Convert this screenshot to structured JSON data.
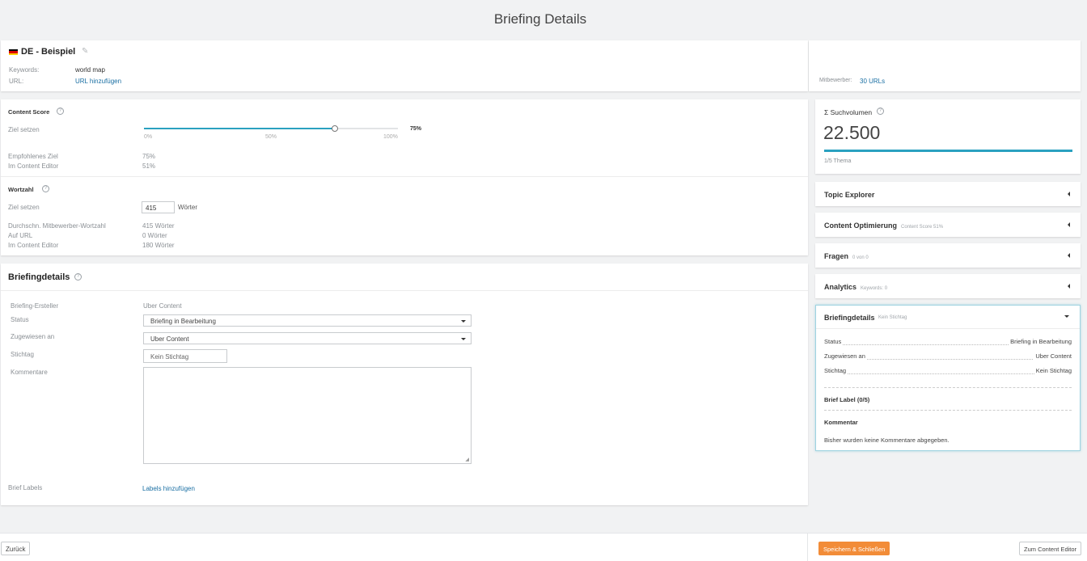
{
  "page_title": "Briefing Details",
  "header": {
    "title": "DE - Beispiel",
    "keywords_label": "Keywords:",
    "keywords_value": "world map",
    "url_label": "URL:",
    "url_link": "URL hinzufügen",
    "competitors_label": "Mitbewerber:",
    "competitors_link": "30 URLs"
  },
  "content_score": {
    "title": "Content Score",
    "goal_label": "Ziel setzen",
    "slider_value": 75,
    "slider_value_text": "75%",
    "ticks": [
      "0%",
      "50%",
      "100%"
    ],
    "recommended_label": "Empfohlenes Ziel",
    "recommended_value": "75%",
    "in_editor_label": "Im Content Editor",
    "in_editor_value": "51%"
  },
  "word_count": {
    "title": "Wortzahl",
    "goal_label": "Ziel setzen",
    "goal_value": "415",
    "unit": "Wörter",
    "avg_label": "Durchschn. Mitbewerber-Wortzahl",
    "avg_value": "415 Wörter",
    "url_label": "Auf URL",
    "url_value": "0 Wörter",
    "editor_label": "Im Content Editor",
    "editor_value": "180 Wörter"
  },
  "briefing": {
    "title": "Briefingdetails",
    "creator_label": "Briefing-Ersteller",
    "creator_value": "Uber Content",
    "status_label": "Status",
    "status_value": "Briefing in Bearbeitung",
    "assigned_label": "Zugewiesen an",
    "assigned_value": "Uber Content",
    "due_label": "Stichtag",
    "due_placeholder": "Kein Stichtag",
    "comments_label": "Kommentare",
    "labels_label": "Brief Labels",
    "labels_link": "Labels hinzufügen"
  },
  "search_volume": {
    "title": "Σ Suchvolumen",
    "value": "22.500",
    "sub": "1/5 Thema",
    "bar_fill": 1.0
  },
  "sidebar_panels": [
    {
      "title": "Topic Explorer",
      "sub": ""
    },
    {
      "title": "Content Optimierung",
      "sub": "Content Score 51%"
    },
    {
      "title": "Fragen",
      "sub": "0 von 0"
    },
    {
      "title": "Analytics",
      "sub": "Keywords: 0"
    }
  ],
  "briefing_panel": {
    "title": "Briefingdetails",
    "sub": "Kein Stichtag",
    "status_label": "Status",
    "status_value": "Briefing in Bearbeitung",
    "assigned_label": "Zugewiesen an",
    "assigned_value": "Uber Content",
    "due_label": "Stichtag",
    "due_value": "Kein Stichtag",
    "labels_title": "Brief Label (0/5)",
    "comments_title": "Kommentar",
    "comments_text": "Bisher wurden keine Kommentare abgegeben."
  },
  "footer": {
    "back": "Zurück",
    "save_close": "Speichern & Schließen",
    "to_editor": "Zum Content Editor"
  },
  "colors": {
    "accent": "#2aa1c0",
    "link": "#1a6fa3",
    "save_button": "#f28c38"
  }
}
